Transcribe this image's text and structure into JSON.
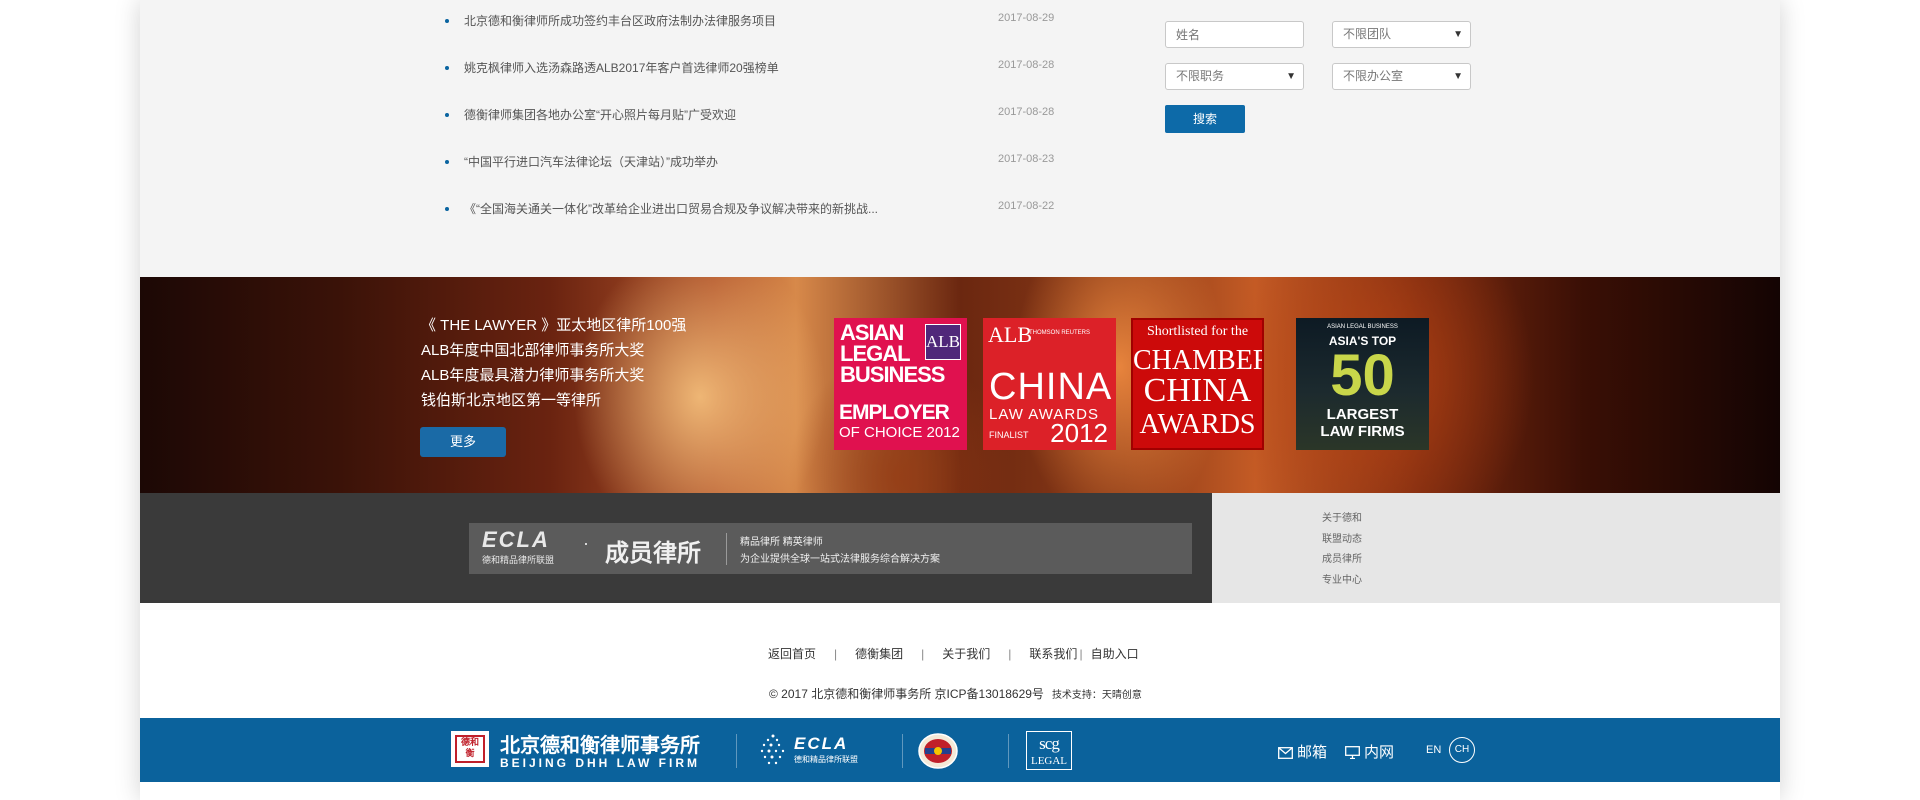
{
  "news": {
    "items": [
      {
        "title": "北京德和衡律师所成功签约丰台区政府法制办法律服务项目",
        "date": "2017-08-29"
      },
      {
        "title": "姚克枫律师入选汤森路透ALB2017年客户首选律师20强榜单",
        "date": "2017-08-28"
      },
      {
        "title": "德衡律师集团各地办公室“开心照片每月贴”广受欢迎",
        "date": "2017-08-28"
      },
      {
        "title": "“中国平行进口汽车法律论坛（天津站）”成功举办",
        "date": "2017-08-23"
      },
      {
        "title": "《“全国海关通关一体化”改革给企业进出口贸易合规及争议解决带来的新挑战...",
        "date": "2017-08-22"
      }
    ]
  },
  "search": {
    "name_placeholder": "姓名",
    "team_value": "不限团队",
    "position_value": "不限职务",
    "office_value": "不限办公室",
    "button_label": "搜索"
  },
  "banner": {
    "lines": [
      "《 THE LAWYER 》亚太地区律所100强",
      "ALB年度中国北部律师事务所大奖",
      "ALB年度最具潜力律师事务所大奖",
      "钱伯斯北京地区第一等律所"
    ],
    "more_label": "更多",
    "awards": {
      "alb_employer": {
        "top": "ASIAN LEGAL BUSINESS",
        "tag": "ALB",
        "bottom1": "EMPLOYER",
        "bottom2": "OF CHOICE 2012"
      },
      "alb_china": {
        "alb": "ALB",
        "tr": "THOMSON REUTERS",
        "china": "CHINA",
        "law_awards": "LAW AWARDS",
        "finalist": "FINALIST",
        "year": "2012"
      },
      "chambers": {
        "shortlisted": "Shortlisted for the",
        "l1": "CHAMBERS",
        "l2": "CHINA",
        "l3": "AWARDS"
      },
      "asia50": {
        "brand": "ASIAN LEGAL BUSINESS",
        "top": "ASIA'S TOP",
        "num": "50",
        "l1": "LARGEST",
        "l2": "LAW FIRMS"
      }
    }
  },
  "ecla": {
    "logo": "ECLA",
    "logo_sub": "德和精品律所联盟",
    "dot": "·",
    "title": "成员律所",
    "line1": "精品律所  精英律师",
    "line2": "为企业提供全球一站式法律服务综合解决方案",
    "side_links": [
      "关于德和",
      "联盟动态",
      "成员律所",
      "专业中心"
    ]
  },
  "footer": {
    "nav": [
      "返回首页",
      "德衡集团",
      "关于我们",
      "联系我们",
      "自助入口"
    ],
    "copyright": "© 2017 北京德和衡律师事务所 京ICP备13018629号",
    "tech": "技术支持：天晴创意"
  },
  "bar": {
    "dhh_seal": "德和衡",
    "dhh_cn": "北京德和衡律师事务所",
    "dhh_en": "BEIJING DHH LAW FIRM",
    "ecla_logo": "ECLA",
    "ecla_sub": "德和精品律所联盟",
    "scg1": "scg",
    "scg2": "LEGAL",
    "mail": "邮箱",
    "intranet": "内网",
    "lang_en": "EN",
    "lang_ch": "CH"
  },
  "colors": {
    "accent_blue": "#0b629c",
    "button_blue": "#0d6aa8"
  }
}
